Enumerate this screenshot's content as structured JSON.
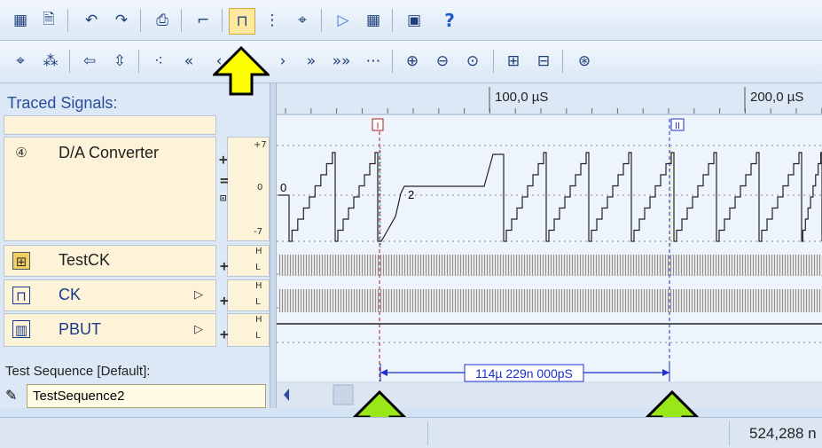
{
  "toolbar1": {
    "icons": [
      "new-project-icon",
      "save-icon",
      "undo-icon",
      "redo-icon",
      "print-preview-icon",
      "signal-edge-icon",
      "trace-cursor-icon",
      "signal-tree-icon",
      "signal-probe-icon",
      "run-icon",
      "stop-icon",
      "window-icon",
      "help-icon"
    ],
    "glyphs": [
      "▦",
      "🗎",
      "↶",
      "↷",
      "⎙",
      "⌐",
      "⊓",
      "⋮",
      "⌖",
      "▷",
      "▦",
      "▣",
      "?"
    ]
  },
  "toolbar2": {
    "glyphs": [
      "⌖",
      "⁂",
      "⇦",
      "⇳",
      "⁖",
      "«",
      "‹",
      "›",
      "»",
      "»»",
      "⋯",
      "⊕",
      "⊖",
      "⊙",
      "⊞",
      "⊟",
      "⊛"
    ],
    "icons": [
      "probe-icon",
      "probe-all-icon",
      "previous-icon",
      "center-icon",
      "first-edge-icon",
      "fast-rewind-icon",
      "step-back-icon",
      "step-forward-icon",
      "fast-forward-icon",
      "last-icon",
      "end-edge-icon",
      "zoom-in-icon",
      "zoom-out-icon",
      "zoom-fit-icon",
      "expand-icon",
      "collapse-icon",
      "settings-icon"
    ]
  },
  "panel": {
    "title": "Traced Signals:"
  },
  "signals": [
    {
      "name": "D/A Converter",
      "icon_glyph": "④",
      "range_top": "+7",
      "range_mid": "0",
      "range_bot": "-7"
    },
    {
      "name": "TestCK",
      "icon_glyph": "⊞",
      "hi": "H",
      "lo": "L"
    },
    {
      "name": "CK",
      "icon_glyph": "⊓",
      "hi": "H",
      "lo": "L",
      "play": "▷"
    },
    {
      "name": "PBUT",
      "icon_glyph": "▥",
      "hi": "H",
      "lo": "L",
      "play": "▷"
    }
  ],
  "ruler": {
    "tick_100": "100,0 µS",
    "tick_200": "200,0 µS"
  },
  "cursors": {
    "c1_label": "I",
    "c2_label": "II",
    "delta": "114µ 229n 000pS"
  },
  "wave_labels": {
    "zero": "0",
    "two": "2"
  },
  "sequence": {
    "label": "Test Sequence [Default]:",
    "value": "TestSequence2"
  },
  "status": {
    "right": "524,288 n"
  },
  "colors": {
    "cursor1": "#b01818",
    "cursor2": "#1a2fd0",
    "arrow_yellow": "#ffff00",
    "arrow_green": "#99e619"
  }
}
